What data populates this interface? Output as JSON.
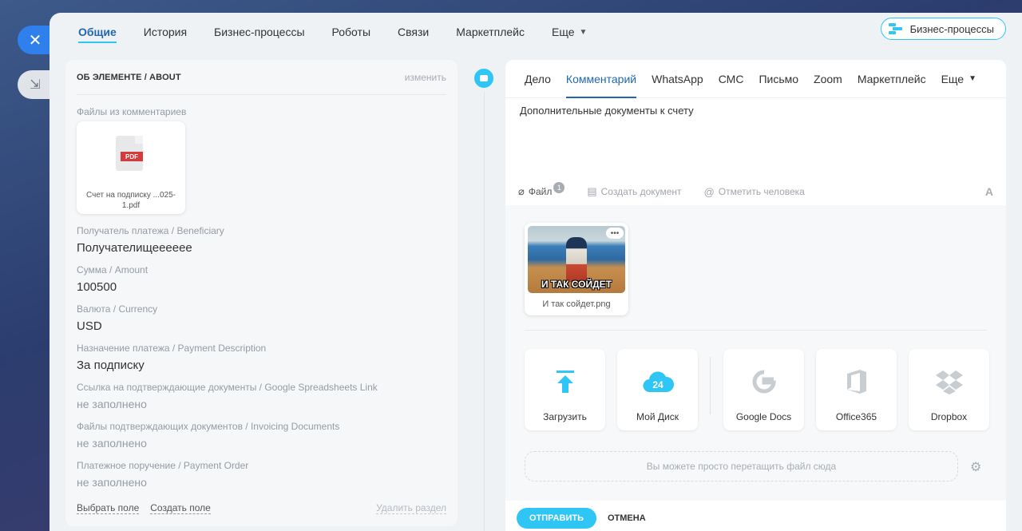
{
  "top_tabs": [
    "Общие",
    "История",
    "Бизнес-процессы",
    "Роботы",
    "Связи",
    "Маркетплейс",
    "Еще"
  ],
  "bp_button_label": "Бизнес-процессы",
  "left": {
    "title": "ОБ ЭЛЕМЕНТЕ / ABOUT",
    "edit": "изменить",
    "files_label": "Файлы из комментариев",
    "file_name": "Счет на подписку ...025-1.pdf",
    "fields": [
      {
        "label": "Получатель платежа / Beneficiary",
        "value": "Получателищееееее"
      },
      {
        "label": "Сумма / Amount",
        "value": "100500"
      },
      {
        "label": "Валюта / Currency",
        "value": "USD"
      },
      {
        "label": "Назначение платежа / Payment Description",
        "value": "За подписку"
      },
      {
        "label": "Ссылка на подтверждающие документы / Google Spreadsheets Link",
        "value": "не заполнено"
      },
      {
        "label": "Файлы подтверждающих документов / Invoicing Documents",
        "value": "не заполнено"
      },
      {
        "label": "Платежное поручение / Payment Order",
        "value": "не заполнено"
      }
    ],
    "footer": {
      "select_field": "Выбрать поле",
      "create_field": "Создать поле",
      "delete_section": "Удалить раздел"
    }
  },
  "editor": {
    "tabs": [
      "Дело",
      "Комментарий",
      "WhatsApp",
      "СМС",
      "Письмо",
      "Zoom",
      "Маркетплейс",
      "Еще"
    ],
    "text": "Дополнительные документы к счету",
    "tools": {
      "file": "Файл",
      "file_count": "1",
      "create_doc": "Создать документ",
      "mention": "Отметить человека",
      "format": "A"
    },
    "attachment": {
      "name": "И так сойдет.png",
      "caption": "И ТАК СОЙДЕТ"
    },
    "sources": [
      "Загрузить",
      "Мой Диск",
      "Google Docs",
      "Office365",
      "Dropbox"
    ],
    "drop_hint": "Вы можете просто перетащить файл сюда",
    "send": "ОТПРАВИТЬ",
    "cancel": "ОТМЕНА"
  }
}
